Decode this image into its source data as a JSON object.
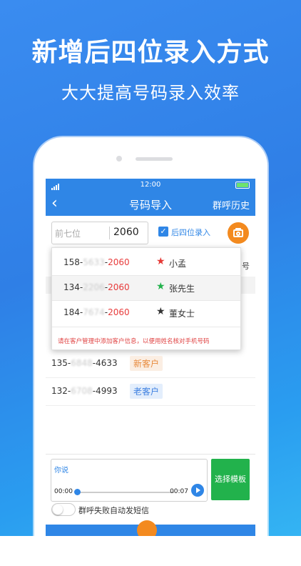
{
  "headline": "新增后四位录入方式",
  "subline": "大大提高号码录入效率",
  "status": {
    "time": "12:00"
  },
  "nav": {
    "back": "‹",
    "title": "号码导入",
    "history": "群呼历史"
  },
  "input": {
    "prefix_placeholder": "前七位",
    "suffix_value": "2060",
    "check_label": "后四位录入"
  },
  "behind": {
    "num_label": "号"
  },
  "dropdown": {
    "items": [
      {
        "prefix": "158-",
        "mid": "5633",
        "last": "2060",
        "name": "小孟",
        "star_color": "#e53935"
      },
      {
        "prefix": "134-",
        "mid": "2206",
        "last": "2060",
        "name": "张先生",
        "star_color": "#22b24c"
      },
      {
        "prefix": "184-",
        "mid": "7674",
        "last": "2060",
        "name": "董女士",
        "star_color": "#333333"
      }
    ],
    "hint": "请在客户管理中添加客户信息，以便用姓名核对手机号码"
  },
  "list": {
    "rows": [
      {
        "prefix": "135-",
        "mid": "6848",
        "suffix": "-4633",
        "tag": "新客户"
      },
      {
        "prefix": "132-",
        "mid": "6708",
        "suffix": "-4993",
        "tag": "老客户"
      }
    ]
  },
  "compose": {
    "voice_label": "你说",
    "time_start": "00:00",
    "time_end": "00:07",
    "template_button": "选择模板",
    "toggle_label": "群呼失败自动发短信"
  }
}
